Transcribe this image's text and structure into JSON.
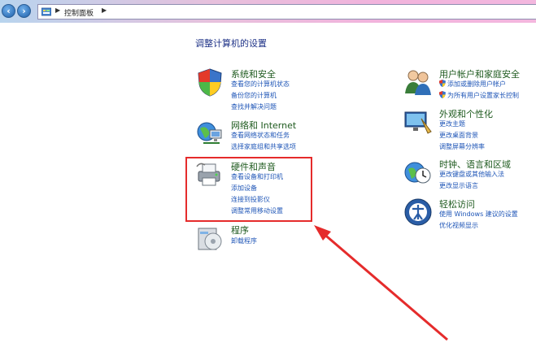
{
  "address_bar": {
    "breadcrumb": "控制面板"
  },
  "page_title": "调整计算机的设置",
  "categories_left": [
    {
      "title": "系统和安全",
      "links": [
        "查看您的计算机状态",
        "备份您的计算机",
        "查找并解决问题"
      ]
    },
    {
      "title": "网络和 Internet",
      "links": [
        "查看网络状态和任务",
        "选择家庭组和共享选项"
      ]
    },
    {
      "title": "硬件和声音",
      "links": [
        "查看设备和打印机",
        "添加设备",
        "连接到投影仪",
        "调整常用移动设置"
      ]
    },
    {
      "title": "程序",
      "links": [
        "卸载程序"
      ]
    }
  ],
  "categories_right": [
    {
      "title": "用户帐户和家庭安全",
      "links": [
        "添加或删除用户帐户",
        "为所有用户设置家长控制"
      ]
    },
    {
      "title": "外观和个性化",
      "links": [
        "更改主题",
        "更改桌面背景",
        "调整屏幕分辨率"
      ]
    },
    {
      "title": "时钟、语言和区域",
      "links": [
        "更改键盘或其他输入法",
        "更改显示语言"
      ]
    },
    {
      "title": "轻松访问",
      "links": [
        "使用 Windows 建议的设置",
        "优化视频显示"
      ]
    }
  ],
  "colors": {
    "heading": "#1e5a1e",
    "link": "#1f56b7",
    "annotation": "#e52b2b"
  }
}
